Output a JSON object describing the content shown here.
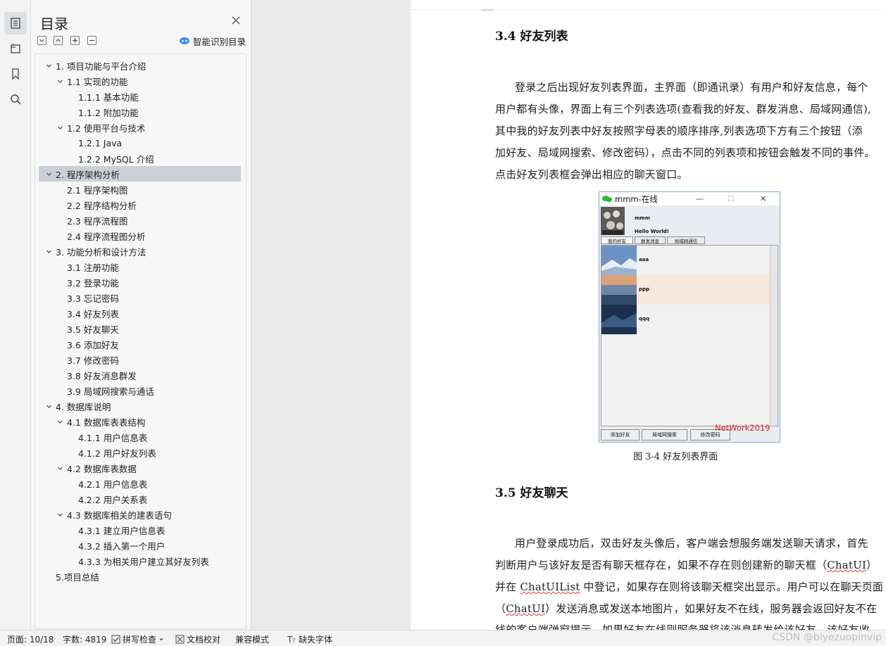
{
  "toc": {
    "title": "目录",
    "smart_label": "智能识别目录",
    "items": [
      {
        "label": "1. 项目功能与平台介绍",
        "level": 0,
        "arrow": true
      },
      {
        "label": "1.1  实现的功能",
        "level": 1,
        "arrow": true
      },
      {
        "label": "1.1.1  基本功能",
        "level": 2,
        "arrow": false
      },
      {
        "label": "1.1.2  附加功能",
        "level": 2,
        "arrow": false
      },
      {
        "label": "1.2  使用平台与技术",
        "level": 1,
        "arrow": true
      },
      {
        "label": "1.2.1 Java",
        "level": 2,
        "arrow": false
      },
      {
        "label": "1.2.2 MySQL 介绍",
        "level": 2,
        "arrow": false
      },
      {
        "label": "2.  程序架构分析",
        "level": 0,
        "arrow": true,
        "selected": true
      },
      {
        "label": "2.1  程序架构图",
        "level": 1,
        "arrow": false
      },
      {
        "label": "2.2  程序结构分析",
        "level": 1,
        "arrow": false
      },
      {
        "label": "2.3  程序流程图",
        "level": 1,
        "arrow": false
      },
      {
        "label": "2.4  程序流程图分析",
        "level": 1,
        "arrow": false
      },
      {
        "label": "3.  功能分析和设计方法",
        "level": 0,
        "arrow": true
      },
      {
        "label": "3.1  注册功能",
        "level": 1,
        "arrow": false
      },
      {
        "label": "3.2  登录功能",
        "level": 1,
        "arrow": false
      },
      {
        "label": "3.3  忘记密码",
        "level": 1,
        "arrow": false
      },
      {
        "label": "3.4  好友列表",
        "level": 1,
        "arrow": false
      },
      {
        "label": "3.5  好友聊天",
        "level": 1,
        "arrow": false
      },
      {
        "label": "3.6  添加好友",
        "level": 1,
        "arrow": false
      },
      {
        "label": "3.7  修改密码",
        "level": 1,
        "arrow": false
      },
      {
        "label": "3.8  好友消息群发",
        "level": 1,
        "arrow": false
      },
      {
        "label": "3.9  局域网搜索与通话",
        "level": 1,
        "arrow": false
      },
      {
        "label": "4.  数据库说明",
        "level": 0,
        "arrow": true
      },
      {
        "label": "4.1  数据库表表结构",
        "level": 1,
        "arrow": true
      },
      {
        "label": "4.1.1  用户信息表",
        "level": 2,
        "arrow": false
      },
      {
        "label": "4.1.2  用户好友列表",
        "level": 2,
        "arrow": false
      },
      {
        "label": "4.2  数据库表数据",
        "level": 1,
        "arrow": true
      },
      {
        "label": "4.2.1  用户信息表",
        "level": 2,
        "arrow": false
      },
      {
        "label": "4.2.2  用户关系表",
        "level": 2,
        "arrow": false
      },
      {
        "label": "4.3  数据库相关的建表语句",
        "level": 1,
        "arrow": true
      },
      {
        "label": "4.3.1  建立用户信息表",
        "level": 2,
        "arrow": false
      },
      {
        "label": "4.3.2  插入第一个用户",
        "level": 2,
        "arrow": false
      },
      {
        "label": "4.3.3  为相关用户建立其好友列表",
        "level": 2,
        "arrow": false
      },
      {
        "label": "5.项目总结",
        "level": 0,
        "arrow": false
      }
    ]
  },
  "doc": {
    "h34": "3.4  好友列表",
    "p1": [
      "登录之后出现好友列表界面，主界面（即通讯录）有用户和好友信息，每个",
      "用户都有头像，界面上有三个列表选项(查看我的好友、群发消息、局域网通信),",
      "其中我的好友列表中好友按照字母表的顺序排序,列表选项下方有三个按钮（添",
      "加好友、局域网搜索、修改密码），点击不同的列表项和按钮会触发不同的事件。",
      "点击好友列表框会弹出相应的聊天窗口。"
    ],
    "figure": {
      "window_title": "mmm-在线",
      "username": "mmm",
      "signature": "Hello World!",
      "tabs": [
        "我的好友",
        "群发消息",
        "局域网通信"
      ],
      "friends": [
        "aaa",
        "ppp",
        "qqq"
      ],
      "buttons": [
        "添加好友",
        "局域网搜索",
        "修改密码"
      ],
      "watermark": "NetWork2019",
      "caption": "图 3-4 好友列表界面"
    },
    "h35": "3.5  好友聊天",
    "p2": {
      "l1": "用户登录成功后，双击好友头像后，客户端会想服务端发送聊天请求，首先",
      "l2a": "判断用户与该好友是否有聊天框存在，如果不存在则创建新的聊天框（",
      "l2b": "ChatUI",
      "l2c": "）",
      "l3a": "并在 ",
      "l3b": "ChatUIList",
      "l3c": " 中登记，如果存在则将该聊天框突出显示。用户可以在聊天页面",
      "l4a": "（",
      "l4b": "ChatUI",
      "l4c": "）发送消息或发送本地图片，如果好友不在线，服务器会返回好友不在",
      "l5": "线的客户端弹窗提示，如果好友在线则服务器将该消息转发给该好友，该好友收"
    }
  },
  "status": {
    "page": "页面: 10/18",
    "words": "字数: 4819",
    "spell": "拼写检查",
    "proof": "文档校对",
    "compat": "兼容模式",
    "missing_font": "缺失字体",
    "watermark": "CSDN @biyezuopinvip"
  }
}
